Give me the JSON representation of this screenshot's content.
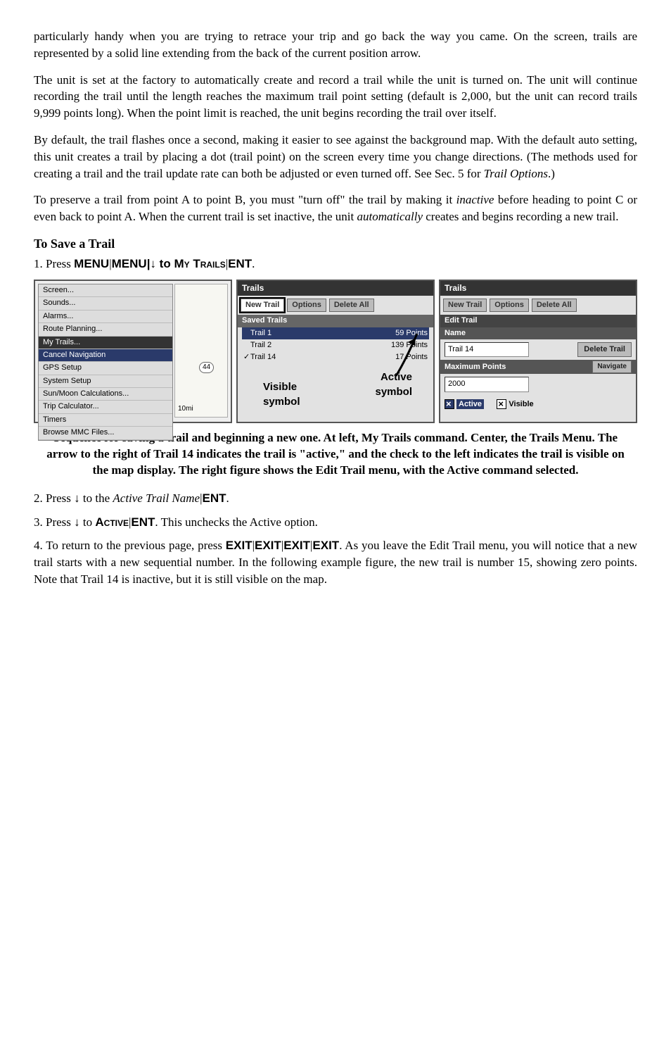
{
  "para1": "particularly handy when you are trying to retrace your trip and go back the way you came. On the screen, trails are represented by a solid line extending from the back of the current position arrow.",
  "para2": "The unit is set at the factory to automatically create and record a trail while the unit is turned on. The unit will continue recording the trail until the length reaches the maximum trail point setting (default is 2,000, but the unit can record trails 9,999 points long). When the point limit is reached, the unit begins recording the trail over itself.",
  "para3a": "By default, the trail flashes once a second, making it easier to see against the background map. With the default auto setting, this unit creates a trail by placing a dot (trail point) on the screen every time you change directions. (The methods used for creating a trail and the trail update rate can both be adjusted or even turned off. See Sec. 5 for ",
  "para3b": "Trail Options",
  "para3c": ".)",
  "para4a": "To preserve a trail from point A to point B, you must \"turn off\" the trail by making it ",
  "para4b": "inactive",
  "para4c": " before heading to point C or even back to point A. When the current trail is set inactive, the unit ",
  "para4d": "automatically",
  "para4e": " creates and begins recording a new trail.",
  "heading1": "To Save a Trail",
  "step1a": "1. Press ",
  "step1b": "MENU",
  "step1c": "|",
  "step1d": "MENU",
  "step1e": "|↓ to ",
  "step1f": "My Trails",
  "step1g": "|",
  "step1h": "ENT",
  "step1i": ".",
  "menu": {
    "items": [
      "Screen...",
      "Sounds...",
      "Alarms...",
      "Route Planning..."
    ],
    "dark": "My Trails...",
    "sel": "Cancel Navigation",
    "rest": [
      "GPS Setup",
      "System Setup",
      "Sun/Moon Calculations...",
      "Trip Calculator...",
      "Timers",
      "Browse MMC Files..."
    ]
  },
  "map": {
    "num": "44",
    "scale": "10mi"
  },
  "panel2": {
    "title": "Trails",
    "btns": [
      "New Trail",
      "Options",
      "Delete All"
    ],
    "subbar": "Saved Trails",
    "rows": [
      {
        "chk": "",
        "name": "Trail 1",
        "pts": "59 Points",
        "sel": true
      },
      {
        "chk": "",
        "name": "Trail 2",
        "pts": "139 Points"
      },
      {
        "chk": "✓",
        "name": "Trail 14",
        "pts": "17 Points"
      }
    ],
    "overlay1": "Visible",
    "overlay1b": "symbol",
    "overlay2": "Active",
    "overlay2b": "symbol"
  },
  "panel3": {
    "title": "Trails",
    "btns": [
      "New Trail",
      "Options",
      "Delete All"
    ],
    "section": "Edit Trail",
    "nameLabel": "Name",
    "nameVal": "Trail 14",
    "deleteBtn": "Delete Trail",
    "maxLabel": "Maximum Points",
    "maxVal": "2000",
    "navBtn": "Navigate",
    "activeLabel": "Active",
    "visibleLabel": "Visible"
  },
  "caption": "Sequence for saving a trail and beginning a new one. At left, My Trails command. Center, the Trails Menu. The arrow to the right of Trail 14 indicates the trail is \"active,\" and the check to the left indicates the trail is visible on the map display. The right figure shows the Edit Trail menu, with the Active command selected.",
  "step2a": "2. Press ↓ to the ",
  "step2b": "Active Trail Name",
  "step2c": "|",
  "step2d": "ENT",
  "step2e": ".",
  "step3a": "3. Press ↓ to ",
  "step3b": "Active",
  "step3c": "|",
  "step3d": "ENT",
  "step3e": ". This unchecks the Active option.",
  "para5a": "4. To return to the previous page, press ",
  "para5b": "EXIT",
  "para5c": "|",
  "para5d": "EXIT",
  "para5e": "|",
  "para5f": "EXIT",
  "para5g": "|",
  "para5h": "EXIT",
  "para5i": ". As you leave the Edit Trail menu, you will notice that a new trail starts with a new sequential number. In the following example figure, the new trail is number 15, showing zero points. Note that Trail 14 is inactive, but it is still visible on the map."
}
